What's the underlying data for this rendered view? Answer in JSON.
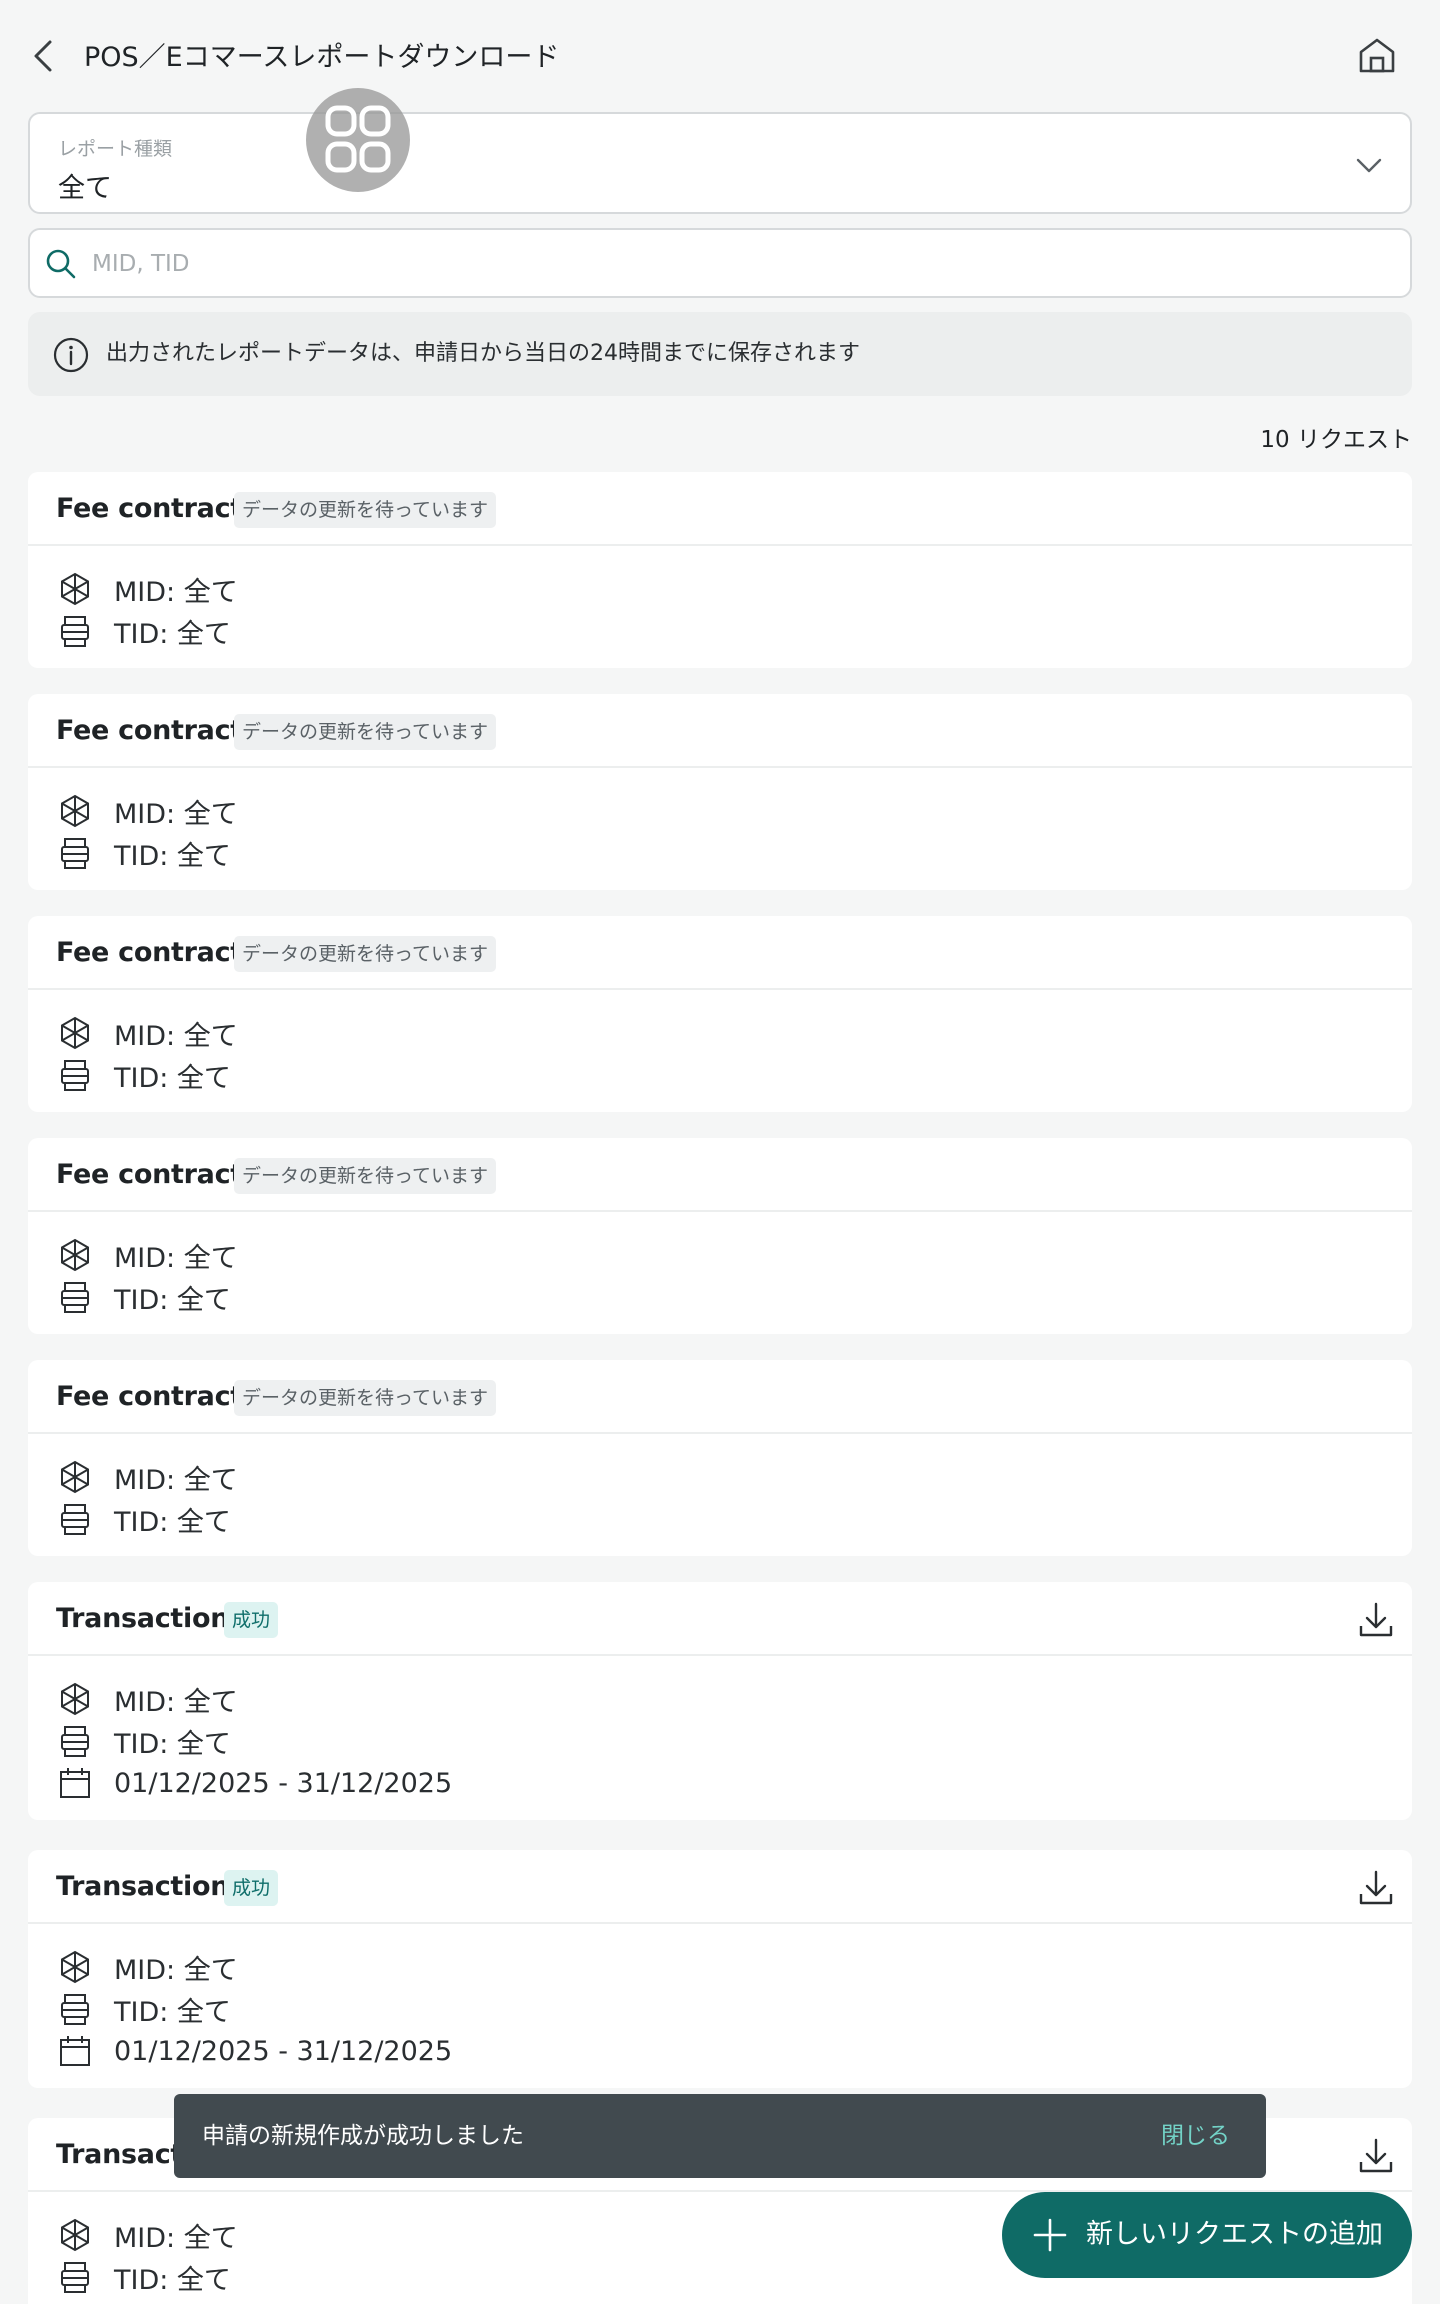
{
  "header": {
    "title": "POS／Eコマースレポートダウンロード",
    "back_icon": "chevron-left-icon",
    "home_icon": "home-icon"
  },
  "report_type": {
    "label": "レポート種類",
    "value": "全て"
  },
  "search": {
    "placeholder": "MID, TID",
    "value": ""
  },
  "info": {
    "text": "出力されたレポートデータは、申請日から当日の24時間までに保存されます"
  },
  "request_count": "10 リクエスト",
  "cards": [
    {
      "title": "Fee contract",
      "status": "データの更新を待っています",
      "mid": "MID:  全て",
      "tid": "TID: 全て"
    },
    {
      "title": "Fee contract",
      "status": "データの更新を待っています",
      "mid": "MID:  全て",
      "tid": "TID: 全て"
    },
    {
      "title": "Fee contract",
      "status": "データの更新を待っています",
      "mid": "MID:  全て",
      "tid": "TID: 全て"
    },
    {
      "title": "Fee contract",
      "status": "データの更新を待っています",
      "mid": "MID:  全て",
      "tid": "TID: 全て"
    },
    {
      "title": "Fee contract",
      "status": "データの更新を待っています",
      "mid": "MID:  全て",
      "tid": "TID: 全て"
    },
    {
      "title": "Transaction",
      "status": "成功",
      "mid": "MID:  全て",
      "tid": "TID: 全て",
      "date": "01/12/2025 - 31/12/2025"
    },
    {
      "title": "Transaction",
      "status": "成功",
      "mid": "MID:  全て",
      "tid": "TID: 全て",
      "date": "01/12/2025 - 31/12/2025"
    },
    {
      "title": "Transacti",
      "mid": "MID:  全て",
      "tid": "TID: 全て"
    }
  ],
  "toast": {
    "message": "申請の新規作成が成功しました",
    "close_label": "閉じる"
  },
  "fab": {
    "label": "新しいリクエストの追加"
  },
  "colors": {
    "accent": "#0f6b66",
    "success_badge_bg": "#ddf3f1",
    "success_badge_text": "#0f6e6a",
    "toast_bg": "#414a4f",
    "toast_action": "#73d3c7"
  }
}
